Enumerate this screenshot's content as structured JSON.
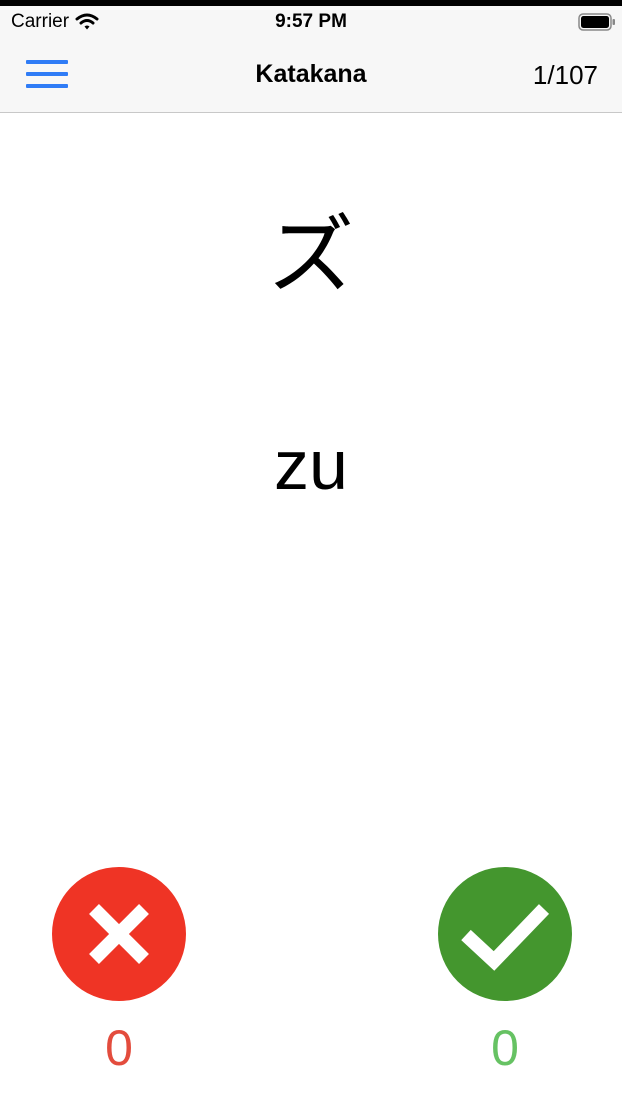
{
  "status_bar": {
    "carrier": "Carrier",
    "time": "9:57 PM",
    "icons": [
      "wifi-icon",
      "battery-icon"
    ]
  },
  "nav": {
    "menu_icon": "hamburger-menu-icon",
    "title": "Katakana",
    "counter": "1/107"
  },
  "card": {
    "kana": "ズ",
    "romaji": "zu"
  },
  "actions": {
    "wrong": {
      "icon": "close-icon",
      "count": "0"
    },
    "right": {
      "icon": "checkmark-icon",
      "count": "0"
    }
  },
  "colors": {
    "accent": "#2f7cf6",
    "wrong": "#ef3425",
    "wrong_text": "#e34c3d",
    "right": "#44962e",
    "right_text": "#66c263"
  }
}
